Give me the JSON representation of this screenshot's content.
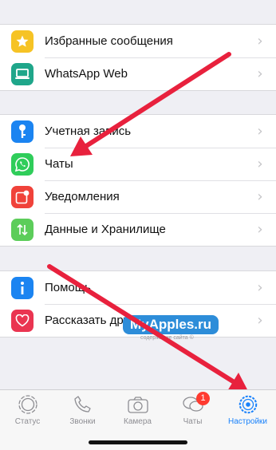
{
  "settings": {
    "group1": [
      {
        "label": "Избранные сообщения",
        "icon": "star-icon",
        "color": "#f6c325"
      },
      {
        "label": "WhatsApp Web",
        "icon": "laptop-icon",
        "color": "#1fa68a"
      }
    ],
    "group2": [
      {
        "label": "Учетная запись",
        "icon": "key-icon",
        "color": "#1b84f1"
      },
      {
        "label": "Чаты",
        "icon": "whatsapp-icon",
        "color": "#2fcd5a"
      },
      {
        "label": "Уведомления",
        "icon": "notification-icon",
        "color": "#f0423a"
      },
      {
        "label": "Данные и Хранилище",
        "icon": "data-arrows-icon",
        "color": "#5ccd5a"
      }
    ],
    "group3": [
      {
        "label": "Помощь",
        "icon": "info-icon",
        "color": "#1b84f1"
      },
      {
        "label": "Рассказать другу",
        "icon": "heart-icon",
        "color": "#ea3551"
      }
    ],
    "chevron": "›"
  },
  "watermark": {
    "title": "MyApples.ru",
    "subtitle": "содержание сайта ©"
  },
  "tabbar": {
    "tabs": [
      {
        "label": "Статус",
        "icon": "status-icon",
        "active": false
      },
      {
        "label": "Звонки",
        "icon": "phone-icon",
        "active": false
      },
      {
        "label": "Камера",
        "icon": "camera-icon",
        "active": false
      },
      {
        "label": "Чаты",
        "icon": "chat-bubbles-icon",
        "active": false,
        "badge": "1"
      },
      {
        "label": "Настройки",
        "icon": "settings-gear-icon",
        "active": true
      }
    ]
  },
  "colors": {
    "accent": "#1a82fb",
    "arrow": "#e8213d",
    "badge": "#ff3b30"
  }
}
